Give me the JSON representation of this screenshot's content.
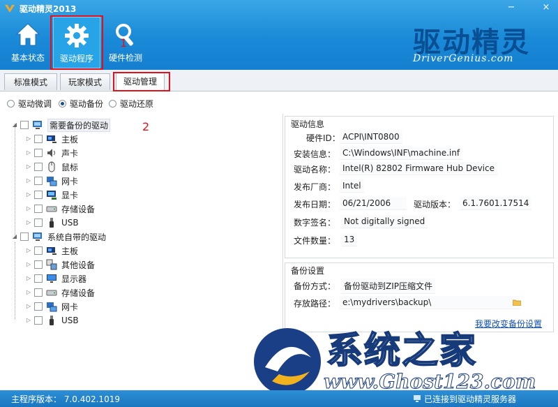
{
  "app": {
    "title": "驱动精灵2013"
  },
  "window_controls": {
    "minimize": "−",
    "close": "×"
  },
  "nav": [
    {
      "label": "基本状态",
      "icon": "home-icon"
    },
    {
      "label": "驱动程序",
      "icon": "gear-icon"
    },
    {
      "label": "硬件检测",
      "icon": "magnifier-icon"
    }
  ],
  "annotations": {
    "one": "1",
    "two": "2"
  },
  "brand": {
    "cn": "驱动精灵",
    "en": "DriverGenius.com"
  },
  "tabs": [
    "标准模式",
    "玩家模式",
    "驱动管理"
  ],
  "radios": [
    {
      "label": "驱动微调",
      "checked": false
    },
    {
      "label": "驱动备份",
      "checked": true
    },
    {
      "label": "驱动还原",
      "checked": false
    }
  ],
  "tree": {
    "group1": {
      "label": "需要备份的驱动",
      "items": [
        {
          "label": "主板",
          "icon": "motherboard-icon"
        },
        {
          "label": "声卡",
          "icon": "speaker-icon"
        },
        {
          "label": "鼠标",
          "icon": "mouse-icon"
        },
        {
          "label": "网卡",
          "icon": "network-icon"
        },
        {
          "label": "显卡",
          "icon": "display-icon"
        },
        {
          "label": "存储设备",
          "icon": "storage-icon"
        },
        {
          "label": "USB",
          "icon": "usb-icon"
        }
      ]
    },
    "group2": {
      "label": "系统自带的驱动",
      "items": [
        {
          "label": "主板",
          "icon": "motherboard-icon"
        },
        {
          "label": "其他设备",
          "icon": "device-icon"
        },
        {
          "label": "显示器",
          "icon": "monitor-icon"
        },
        {
          "label": "存储设备",
          "icon": "storage-icon"
        },
        {
          "label": "网卡",
          "icon": "network-icon"
        },
        {
          "label": "USB",
          "icon": "usb-icon"
        }
      ]
    }
  },
  "driver_info": {
    "title": "驱动信息",
    "hardware_id_label": "硬件ID：",
    "hardware_id": "ACPI\\INT0800",
    "install_info_label": "安装信息：",
    "install_info": "C:\\Windows\\INF\\machine.inf",
    "name_label": "驱动名称：",
    "name": "Intel(R) 82802 Firmware Hub Device",
    "vendor_label": "发布厂商：",
    "vendor": "Intel",
    "date_label": "发布日期：",
    "date": "06/21/2006",
    "version_label": "驱动版本：",
    "version": "6.1.7601.17514",
    "signature_label": "数字签名：",
    "signature": "Not digitally signed",
    "file_count_label": "文件数量：",
    "file_count": "13"
  },
  "backup_settings": {
    "title": "备份设置",
    "method_label": "备份方式：",
    "method": "备份驱动到ZIP压缩文件",
    "path_label": "存放路径：",
    "path": "e:\\mydrivers\\backup\\",
    "change_link": "我要改变备份设置"
  },
  "watermark": {
    "cn": "系统之家",
    "url": "www.Ghost123.com"
  },
  "status": {
    "version": "主程序版本： 7.0.402.1019",
    "connection": "已连接到驱动精灵服务器"
  },
  "colors": {
    "header": "#1a8ad8",
    "accent_red": "#e2101a",
    "link": "#1250b3"
  }
}
